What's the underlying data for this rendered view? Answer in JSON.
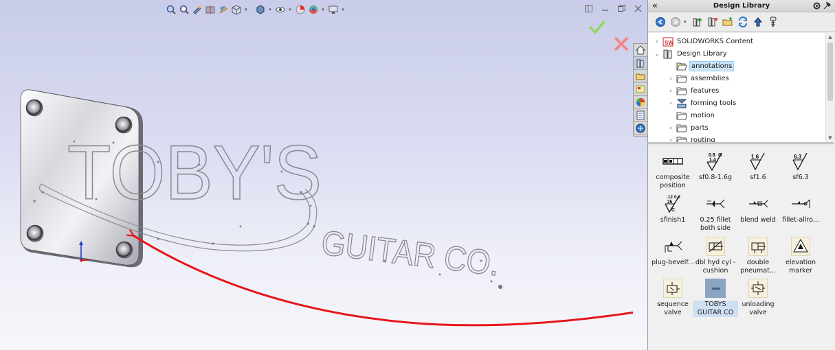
{
  "panel": {
    "title": "Design Library",
    "tree": [
      {
        "label": "SOLIDWORKS Content",
        "expanded": false,
        "icon": "solidworks-content-icon"
      },
      {
        "label": "Design Library",
        "expanded": true,
        "icon": "design-library-icon"
      },
      {
        "label": "annotations",
        "selected": true,
        "icon": "folder-open-icon"
      },
      {
        "label": "assemblies",
        "icon": "folder-icon"
      },
      {
        "label": "features",
        "icon": "folder-icon"
      },
      {
        "label": "forming tools",
        "icon": "forming-tools-icon"
      },
      {
        "label": "motion",
        "icon": "folder-icon"
      },
      {
        "label": "parts",
        "icon": "folder-icon"
      },
      {
        "label": "routing",
        "icon": "folder-icon"
      }
    ],
    "items": [
      {
        "label": "composite position"
      },
      {
        "label": "sf0.8-1.6g"
      },
      {
        "label": "sf1.6"
      },
      {
        "label": "sf6.3"
      },
      {
        "label": "sfinish1"
      },
      {
        "label": "0.25 fillet both side"
      },
      {
        "label": "blend weld"
      },
      {
        "label": "fillet-allro..."
      },
      {
        "label": "plug-bevelf..."
      },
      {
        "label": "dbl hyd cyl - cushion"
      },
      {
        "label": "double pneumat..."
      },
      {
        "label": "elevation marker"
      },
      {
        "label": "sequence valve"
      },
      {
        "label": "TOBYS GUITAR CO",
        "selected": true
      },
      {
        "label": "unloading valve"
      }
    ],
    "thumbs": {
      "sf08": {
        "top": "0.8",
        "mid": "1.4",
        "g": "G"
      },
      "sf16": "1.6",
      "sf63": "6.3",
      "sfinish": {
        "a": ".12",
        "b": "0.2",
        "c": "25",
        "d": "C"
      }
    }
  },
  "model": {
    "logo_line1": "TOBY'S",
    "logo_line2": "GUITAR CO."
  },
  "colors": {
    "accent_red": "#e8141a",
    "confirm_green": "#7ec850",
    "cancel_red": "#e36b6b",
    "selection": "#cce4f7"
  }
}
